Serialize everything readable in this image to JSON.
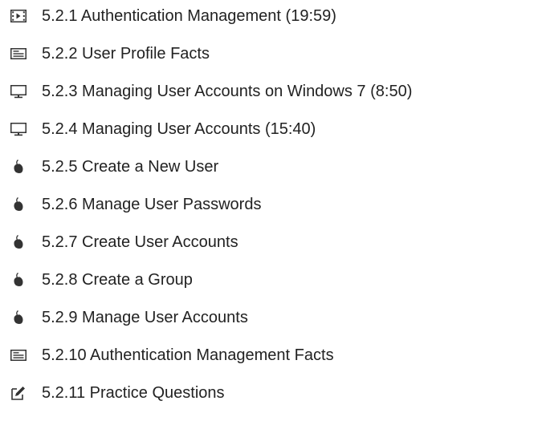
{
  "lessons": {
    "items": [
      {
        "icon": "video-icon",
        "label": "5.2.1 Authentication Management (19:59)"
      },
      {
        "icon": "document-icon",
        "label": "5.2.2 User Profile Facts"
      },
      {
        "icon": "monitor-icon",
        "label": "5.2.3 Managing User Accounts on Windows 7 (8:50)"
      },
      {
        "icon": "monitor-icon",
        "label": "5.2.4 Managing User Accounts (15:40)"
      },
      {
        "icon": "mouse-icon",
        "label": "5.2.5 Create a New User"
      },
      {
        "icon": "mouse-icon",
        "label": "5.2.6 Manage User Passwords"
      },
      {
        "icon": "mouse-icon",
        "label": "5.2.7 Create User Accounts"
      },
      {
        "icon": "mouse-icon",
        "label": "5.2.8 Create a Group"
      },
      {
        "icon": "mouse-icon",
        "label": "5.2.9 Manage User Accounts"
      },
      {
        "icon": "document-icon",
        "label": "5.2.10 Authentication Management Facts"
      },
      {
        "icon": "quiz-icon",
        "label": "5.2.11 Practice Questions"
      }
    ]
  }
}
